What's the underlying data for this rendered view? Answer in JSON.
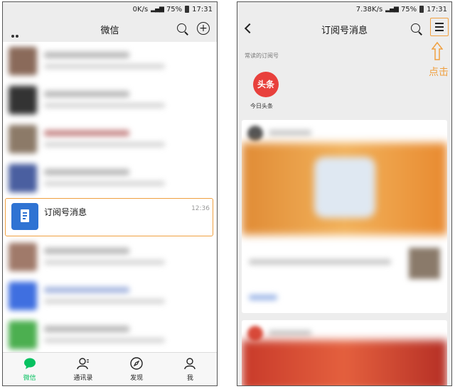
{
  "left_phone": {
    "status": {
      "speed": "0K/s",
      "battery": "75%",
      "time": "17:31"
    },
    "title": "微信",
    "subscription_row": {
      "name": "订阅号消息",
      "time": "12:36"
    },
    "tabs": [
      {
        "label": "微信",
        "icon": "chat-icon",
        "active": true
      },
      {
        "label": "通讯录",
        "icon": "contacts-icon",
        "active": false
      },
      {
        "label": "发现",
        "icon": "compass-icon",
        "active": false
      },
      {
        "label": "我",
        "icon": "profile-icon",
        "active": false
      }
    ]
  },
  "right_phone": {
    "status": {
      "speed": "7.38K/s",
      "battery": "75%",
      "time": "17:31"
    },
    "title": "订阅号消息",
    "section_label": "常读的订阅号",
    "frequent_account": {
      "icon_text": "头条",
      "name": "今日头条"
    },
    "annotation": "点击"
  },
  "colors": {
    "accent_orange": "#f0a040",
    "wechat_green": "#07c160",
    "sub_blue": "#2f73d3",
    "toutiao_red": "#e8403c"
  }
}
